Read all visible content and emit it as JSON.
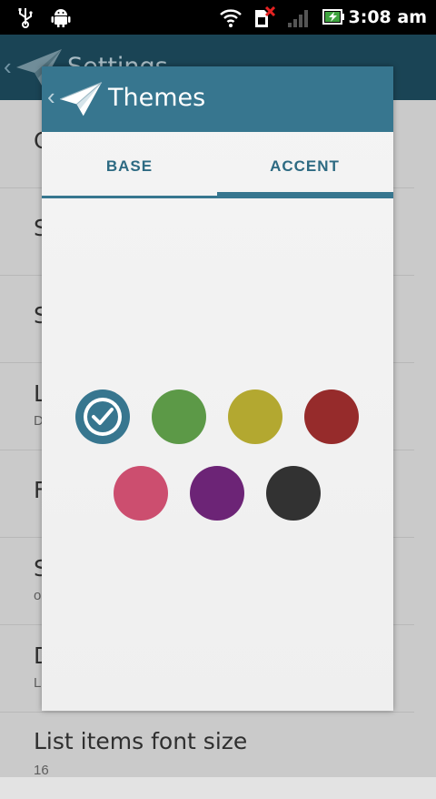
{
  "status_bar": {
    "time": "3:08 am",
    "icons": [
      "usb-icon",
      "android-debug-icon",
      "wifi-icon",
      "no-sim-icon",
      "signal-icon",
      "battery-charging-icon"
    ]
  },
  "background_screen": {
    "title": "Settings",
    "items": [
      {
        "title": "C",
        "subtitle": ""
      },
      {
        "title": "S",
        "subtitle": ""
      },
      {
        "title": "S",
        "subtitle": ""
      },
      {
        "title": "L",
        "subtitle": "D"
      },
      {
        "title": "F",
        "subtitle": ""
      },
      {
        "title": "S",
        "subtitle": "o"
      },
      {
        "title": "D",
        "subtitle": "L"
      },
      {
        "title": "List items font size",
        "subtitle": "16"
      }
    ]
  },
  "dialog": {
    "title": "Themes",
    "tabs": [
      {
        "label": "BASE",
        "active": false
      },
      {
        "label": "ACCENT",
        "active": true
      }
    ],
    "accent_colors": [
      {
        "name": "blue",
        "hex": "#37768f",
        "selected": true
      },
      {
        "name": "green",
        "hex": "#5c9947"
      },
      {
        "name": "olive",
        "hex": "#b3a830"
      },
      {
        "name": "red",
        "hex": "#962b2b"
      },
      {
        "name": "pink",
        "hex": "#cc4e6f"
      },
      {
        "name": "purple",
        "hex": "#6c2476"
      },
      {
        "name": "dark-gray",
        "hex": "#323232"
      }
    ]
  },
  "colors": {
    "header": "#37768f",
    "app_bar": "#1d4a5d"
  }
}
